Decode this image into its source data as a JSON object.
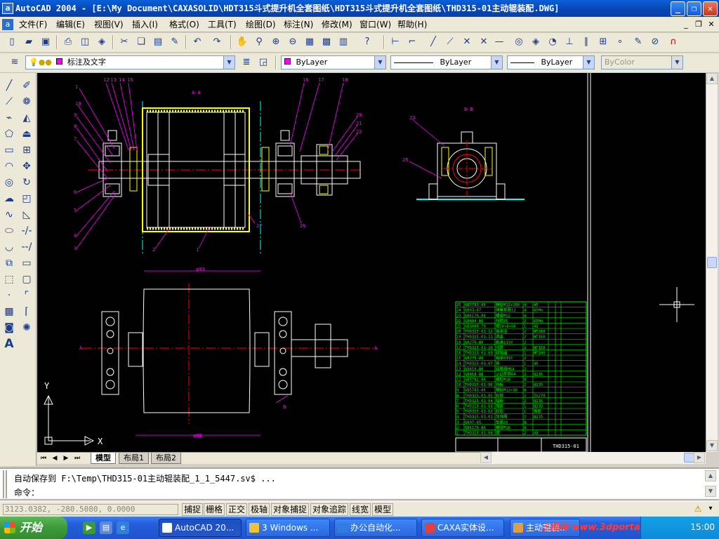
{
  "title": "AutoCAD 2004 - [E:\\My Document\\CAXASOLID\\HDT315斗式提升机全套图纸\\HDT315斗式提升机全套图纸\\THD315-01主动辊装配.DWG]",
  "window_controls": {
    "minimize": "_",
    "restore": "❐",
    "close": "✕"
  },
  "menu": [
    "文件(F)",
    "编辑(E)",
    "视图(V)",
    "插入(I)",
    "格式(O)",
    "工具(T)",
    "绘图(D)",
    "标注(N)",
    "修改(M)",
    "窗口(W)",
    "帮助(H)"
  ],
  "layers": {
    "current_layer": "标注及文字",
    "color": "ByLayer",
    "linetype": "ByLayer",
    "lineweight": "ByLayer",
    "plotstyle": "ByColor"
  },
  "drawing": {
    "section_aa": "A-A",
    "section_bb": "B-B",
    "balloons_top": [
      "1",
      "2",
      "3",
      "4",
      "5",
      "6",
      "7",
      "8",
      "9",
      "10",
      "11",
      "12",
      "13",
      "14",
      "15",
      "16",
      "17",
      "18",
      "19",
      "20",
      "21",
      "22",
      "23",
      "24",
      "25",
      "26",
      "27"
    ],
    "dim_top": "φ93",
    "dim_bottom": "φ88",
    "sheet_no": "THD315-01",
    "ucs_x": "X",
    "ucs_y": "Y",
    "section_mark_a": "A",
    "section_mark_b": "B",
    "bom_rows": [
      [
        "25",
        "GB5783-86",
        "螺栓M12×100",
        "4",
        "45",
        "",
        "",
        ""
      ],
      [
        "24",
        "GB93-87",
        "弹簧垫圈12",
        "4",
        "65Mn",
        "",
        "",
        ""
      ],
      [
        "23",
        "GB6170-86",
        "螺母M12",
        "4",
        "",
        "",
        "",
        ""
      ],
      [
        "22",
        "GB894-86",
        "挡圈35",
        "2",
        "65Mn",
        "",
        "",
        ""
      ],
      [
        "21",
        "GB1096-79",
        "键10×8×56",
        "1",
        "45",
        "",
        "",
        ""
      ],
      [
        "20",
        "THD315-01-12",
        "轴承座",
        "2",
        "HT200",
        "",
        "",
        ""
      ],
      [
        "19",
        "THD315-01-11",
        "透盖",
        "2",
        "HT150",
        "",
        "",
        ""
      ],
      [
        "18",
        "GB276-89",
        "轴承1310",
        "2",
        "",
        "",
        "",
        ""
      ],
      [
        "17",
        "THD315-01-10",
        "闷盖",
        "2",
        "HT150",
        "",
        "",
        ""
      ],
      [
        "16",
        "THD315-01-09",
        "联轴器",
        "1",
        "HT200",
        "",
        "",
        ""
      ],
      [
        "15",
        "GB276-89",
        "轴承6315",
        "2",
        "",
        "",
        "",
        ""
      ],
      [
        "14",
        "THD315-01-07",
        "轴",
        "1",
        "45",
        "",
        "",
        ""
      ],
      [
        "13",
        "GB810-88",
        "圆螺母M64",
        "2",
        "",
        "",
        "",
        ""
      ],
      [
        "12",
        "GB858-88",
        "止动垫圈64",
        "2",
        "Q235",
        "",
        "",
        ""
      ],
      [
        "11",
        "GB5782-86",
        "螺栓M16",
        "8",
        "",
        "",
        "",
        ""
      ],
      [
        "10",
        "THD315-01-06",
        "挡板",
        "2",
        "Q235",
        "",
        "",
        ""
      ],
      [
        "9",
        "GB5783-86",
        "螺栓M12×30",
        "8",
        "",
        "",
        "",
        ""
      ],
      [
        "8",
        "THD315-01-05",
        "轮毂",
        "2",
        "ZG270",
        "",
        "",
        ""
      ],
      [
        "7",
        "THD315-01-04",
        "辐板",
        "2",
        "Q235",
        "",
        "",
        ""
      ],
      [
        "6",
        "THD315-01-03",
        "筒皮",
        "1",
        "Q235",
        "",
        "",
        ""
      ],
      [
        "5",
        "THD315-01-02",
        "胶层",
        "1",
        "橡胶",
        "",
        "",
        ""
      ],
      [
        "4",
        "THD315-01-01",
        "加强圈",
        "2",
        "Q235",
        "",
        "",
        ""
      ],
      [
        "3",
        "GB97-85",
        "垫圈16",
        "8",
        "",
        "",
        "",
        ""
      ],
      [
        "2",
        "GB6170-86",
        "螺母M16",
        "8",
        "",
        "",
        "",
        ""
      ],
      [
        "1",
        "THD315-01-08",
        "键",
        "2",
        "45",
        "",
        "",
        ""
      ]
    ]
  },
  "layout_tabs": [
    "模型",
    "布局1",
    "布局2"
  ],
  "command": {
    "history": "自动保存到 F:\\Temp\\THD315-01主动辊装配_1_1_5447.sv$ ...",
    "prompt": "命令："
  },
  "status": {
    "coords": "3123.0382, -280.5080, 0.0000",
    "toggles": [
      "捕捉",
      "栅格",
      "正交",
      "极轴",
      "对象捕捉",
      "对象追踪",
      "线宽",
      "模型"
    ]
  },
  "taskbar": {
    "start": "开始",
    "tasks": [
      "AutoCAD 20...",
      "3 Windows ...",
      "办公自动化...",
      "CAXA实体设...",
      "主动辊装..."
    ],
    "watermark": "三维网 www.3dportal.com",
    "clock": "15:00"
  },
  "colors": {
    "canvas": "#000000",
    "line_white": "#ffffff",
    "line_yellow": "#ffff00",
    "line_cyan": "#00ffff",
    "line_magenta": "#ff00ff",
    "line_green": "#00ff00",
    "line_red": "#ff0000"
  }
}
